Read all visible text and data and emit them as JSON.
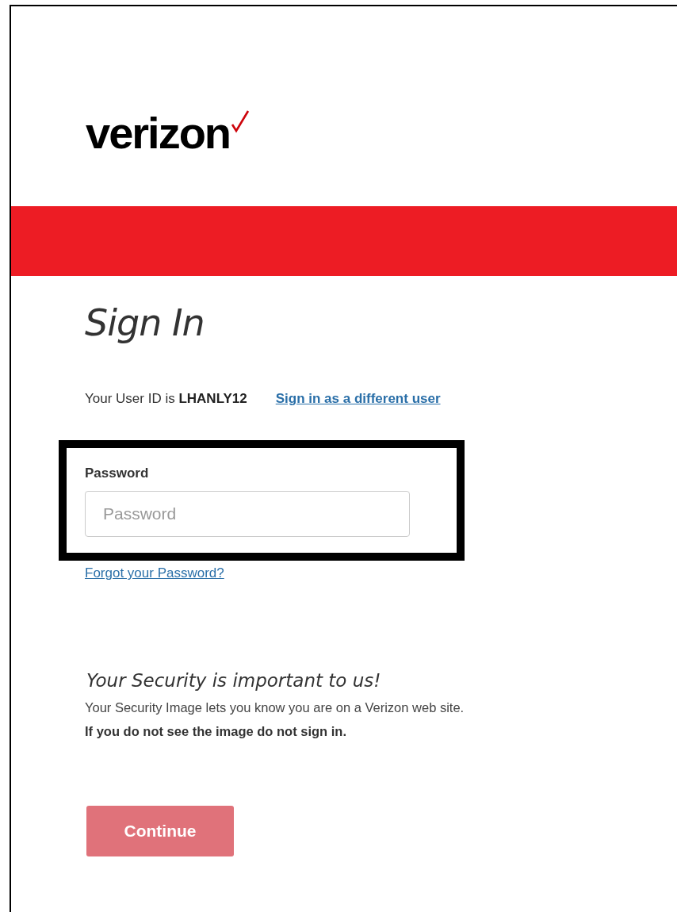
{
  "logo": {
    "text": "verizon"
  },
  "heading": "Sign In",
  "user_id": {
    "prefix": "Your User ID is",
    "value": "LHANLY12",
    "switch_link": "Sign in as a different user"
  },
  "password": {
    "label": "Password",
    "placeholder": "Password",
    "highlighted": true
  },
  "forgot_link": "Forgot your Password?",
  "security": {
    "title": "Your Security is important to us!",
    "text": "Your Security Image lets you know you are on a Verizon web site.",
    "warning": "If you do not see the image do not sign in."
  },
  "continue_button": {
    "label": "Continue",
    "disabled": true
  }
}
